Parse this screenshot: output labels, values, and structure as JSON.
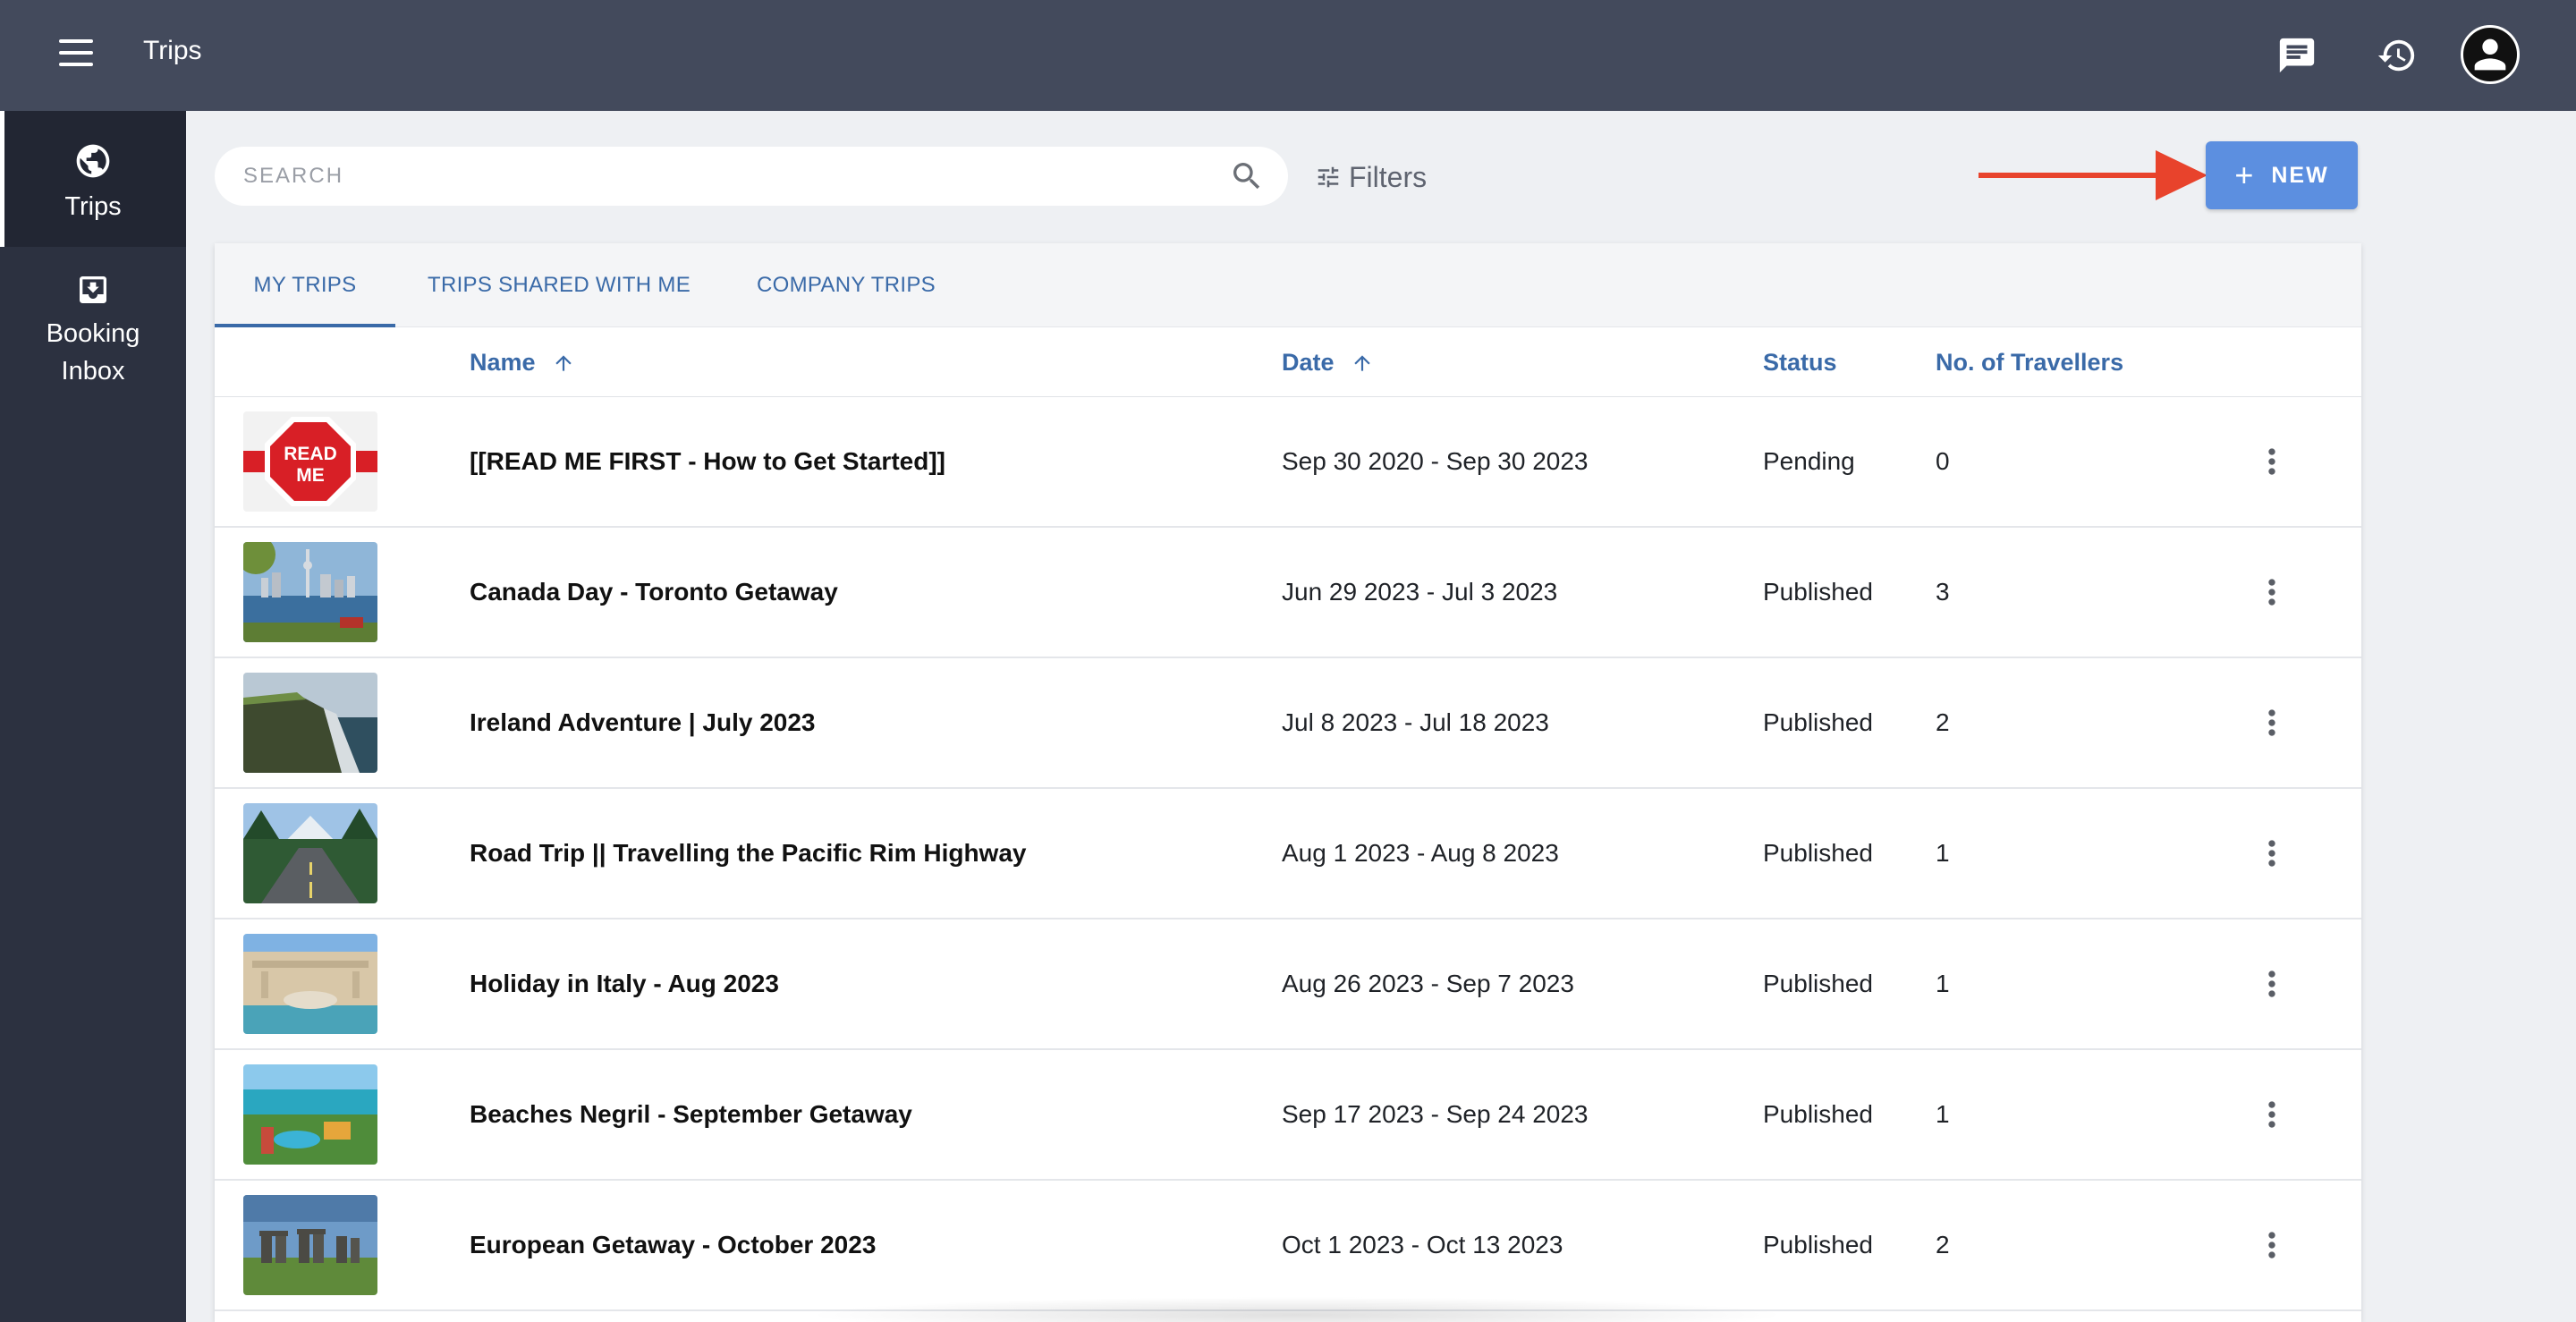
{
  "header": {
    "title": "Trips",
    "icons": [
      "menu-icon",
      "chat-icon",
      "history-icon",
      "account-icon"
    ]
  },
  "sidebar": {
    "items": [
      {
        "label": "Trips",
        "icon": "globe-icon",
        "active": true
      },
      {
        "label": "Booking\nInbox",
        "icon": "inbox-icon",
        "active": false
      }
    ]
  },
  "toolbar": {
    "search_placeholder": "SEARCH",
    "filters_label": "Filters",
    "new_label": "NEW"
  },
  "tabs": [
    {
      "label": "MY TRIPS",
      "active": true
    },
    {
      "label": "TRIPS SHARED WITH ME",
      "active": false
    },
    {
      "label": "COMPANY TRIPS",
      "active": false
    }
  ],
  "table": {
    "columns": {
      "name": "Name",
      "date": "Date",
      "status": "Status",
      "travellers": "No. of Travellers"
    },
    "rows": [
      {
        "name": "[[READ ME FIRST - How to Get Started]]",
        "date": "Sep 30 2020 - Sep 30 2023",
        "status": "Pending",
        "travellers": "0",
        "thumb": "readme",
        "thumb_text": "READ ME"
      },
      {
        "name": "Canada Day - Toronto Getaway",
        "date": "Jun 29 2023 - Jul 3 2023",
        "status": "Published",
        "travellers": "3",
        "thumb": "toronto"
      },
      {
        "name": "Ireland Adventure | July 2023",
        "date": "Jul 8 2023 - Jul 18 2023",
        "status": "Published",
        "travellers": "2",
        "thumb": "cliffs"
      },
      {
        "name": "Road Trip || Travelling the Pacific Rim Highway",
        "date": "Aug 1 2023 - Aug 8 2023",
        "status": "Published",
        "travellers": "1",
        "thumb": "road"
      },
      {
        "name": "Holiday in Italy - Aug 2023",
        "date": "Aug 26 2023 - Sep 7 2023",
        "status": "Published",
        "travellers": "1",
        "thumb": "fountain"
      },
      {
        "name": "Beaches Negril - September Getaway",
        "date": "Sep 17 2023 - Sep 24 2023",
        "status": "Published",
        "travellers": "1",
        "thumb": "beach"
      },
      {
        "name": "European Getaway - October 2023",
        "date": "Oct 1 2023 - Oct 13 2023",
        "status": "Published",
        "travellers": "2",
        "thumb": "stonehenge"
      }
    ]
  },
  "colors": {
    "topbar": "#434a5c",
    "sidebar": "#2c3140",
    "accent": "#3a6aa8",
    "new_button": "#5c8fe0",
    "arrow": "#e8432c"
  }
}
